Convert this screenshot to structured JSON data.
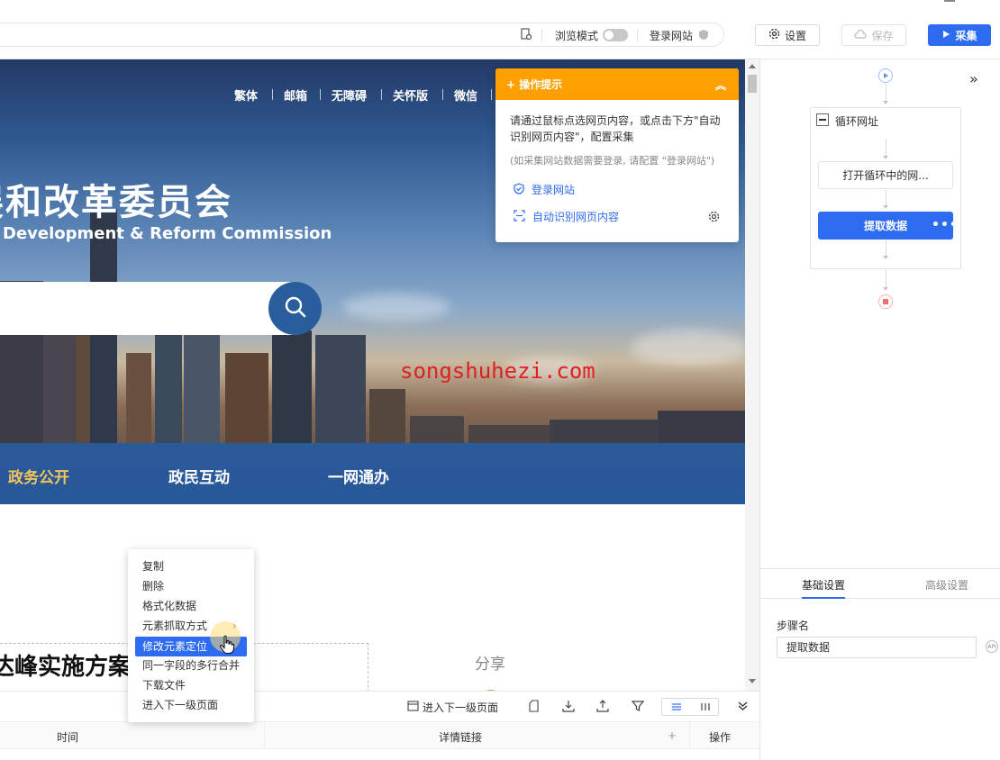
{
  "toolbar": {
    "browse_mode_label": "浏览模式",
    "login_site_label": "登录网站",
    "settings_label": "设置",
    "save_label": "保存",
    "collect_label": "采集",
    "accent_color": "#2d6cf0"
  },
  "webpage": {
    "top_links": [
      "繁体",
      "邮箱",
      "无障碍",
      "关怀版",
      "微信"
    ],
    "title_cn": "发展和改革委员会",
    "title_en": "Development & Reform Commission",
    "nav_items": [
      "政务公开",
      "政民互动",
      "一网通办"
    ],
    "watermark": "songshuhezi.com",
    "article_title": "达峰实施方案",
    "share_label": "分享"
  },
  "hint_panel": {
    "title": "操作提示",
    "body": "请通过鼠标点选网页内容，或点击下方\"自动识别网页内容\"，配置采集",
    "note": "(如采集网站数据需要登录, 请配置 \"登录网站\")",
    "login_link": "登录网站",
    "auto_detect_link": "自动识别网页内容",
    "header_color": "#ff9f00"
  },
  "context_menu": {
    "items": [
      "复制",
      "删除",
      "格式化数据",
      "元素抓取方式",
      "修改元素定位",
      "同一字段的多行合并",
      "下载文件",
      "进入下一级页面"
    ],
    "active_item": "修改元素定位"
  },
  "data_panel": {
    "enter_next_level_label": "进入下一级页面",
    "columns": [
      "时间",
      "详情链接",
      "操作"
    ],
    "add_column_symbol": "+"
  },
  "workflow": {
    "loop_label": "循环网址",
    "open_node_label": "打开循环中的网...",
    "extract_node_label": "提取数据",
    "more_symbol": "•••"
  },
  "settings_panel": {
    "tabs": [
      "基础设置",
      "高级设置"
    ],
    "active_tab": "基础设置",
    "step_name_label": "步骤名",
    "step_name_value": "提取数据",
    "api_badge": "API"
  }
}
